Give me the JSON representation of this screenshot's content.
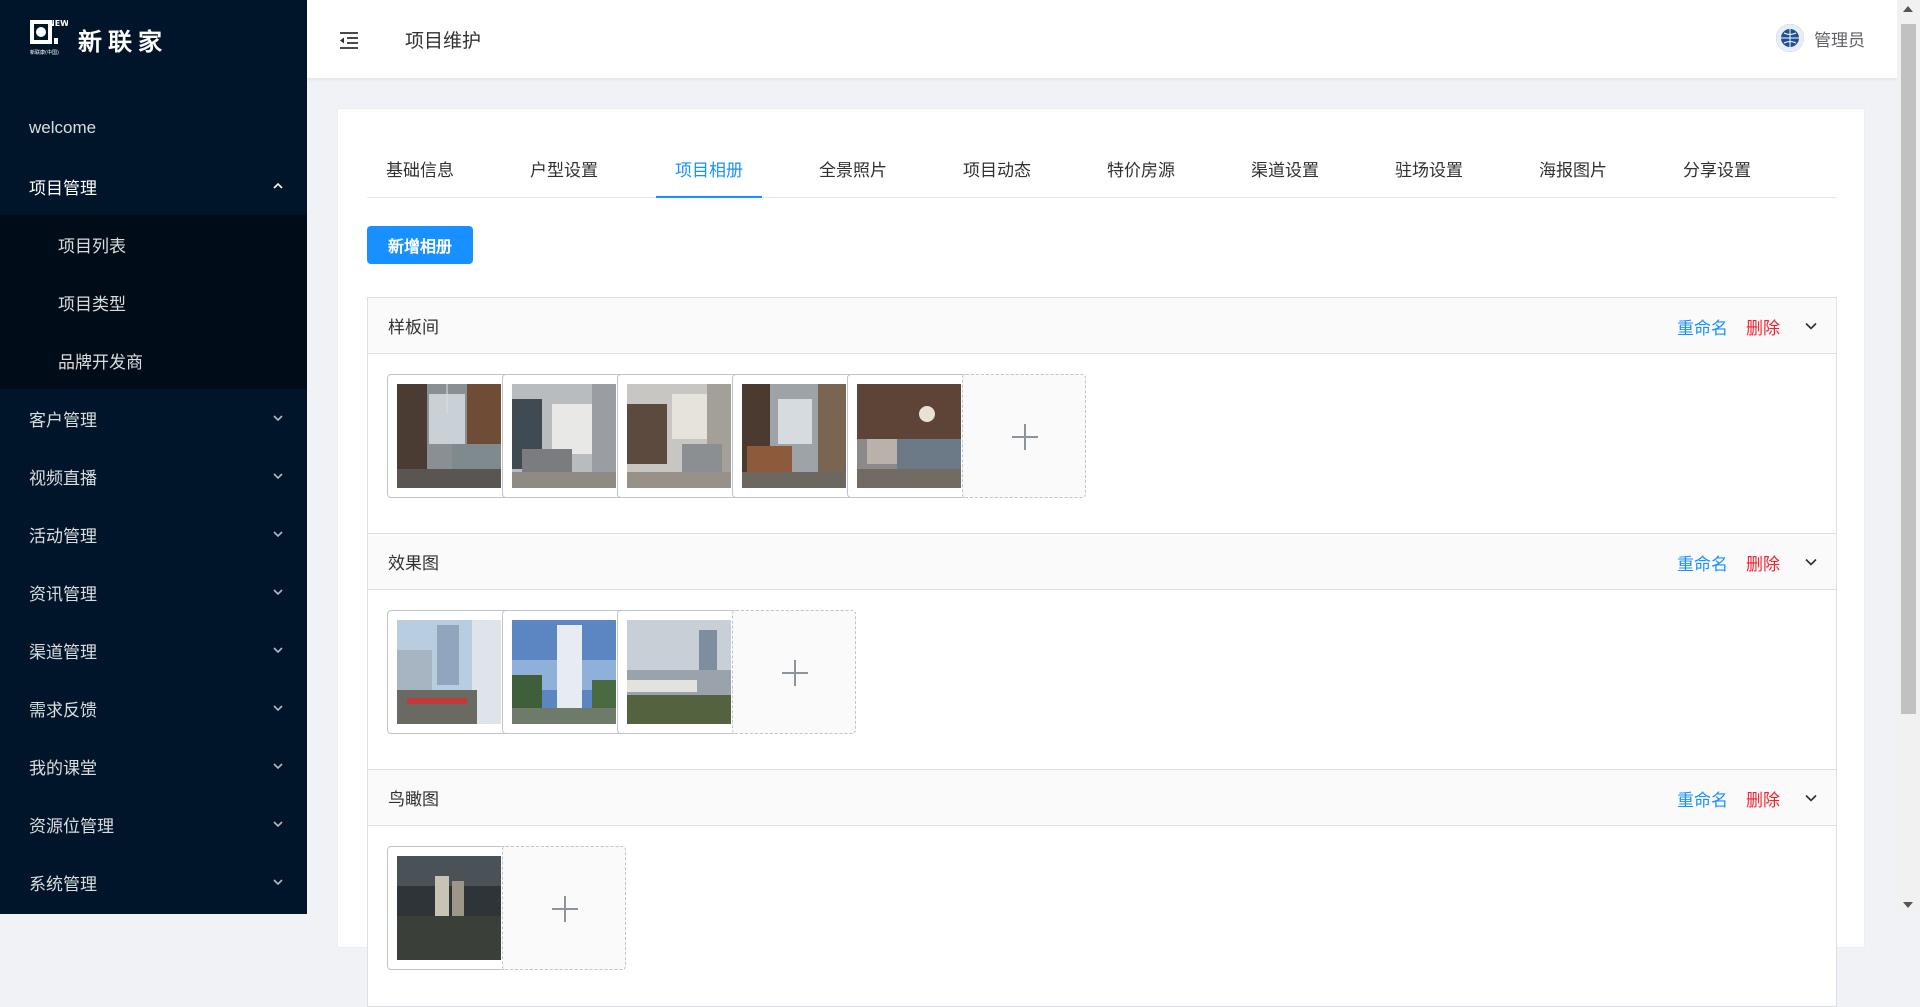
{
  "brand": {
    "name": "新联家",
    "logo_word": "NEW",
    "logo_caption": "新联康(中国)"
  },
  "sidebar": {
    "items": [
      {
        "label": "welcome"
      },
      {
        "label": "项目管理",
        "expanded": true
      },
      {
        "label": "客户管理"
      },
      {
        "label": "视频直播"
      },
      {
        "label": "活动管理"
      },
      {
        "label": "资讯管理"
      },
      {
        "label": "渠道管理"
      },
      {
        "label": "需求反馈"
      },
      {
        "label": "我的课堂"
      },
      {
        "label": "资源位管理"
      },
      {
        "label": "系统管理"
      }
    ],
    "subitems": [
      {
        "label": "项目列表"
      },
      {
        "label": "项目类型"
      },
      {
        "label": "品牌开发商"
      }
    ]
  },
  "header": {
    "title": "项目维护",
    "user": "管理员"
  },
  "tabs": [
    {
      "label": "基础信息"
    },
    {
      "label": "户型设置"
    },
    {
      "label": "项目相册",
      "active": true
    },
    {
      "label": "全景照片"
    },
    {
      "label": "项目动态"
    },
    {
      "label": "特价房源"
    },
    {
      "label": "渠道设置"
    },
    {
      "label": "驻场设置"
    },
    {
      "label": "海报图片"
    },
    {
      "label": "分享设置"
    }
  ],
  "add_album_label": "新增相册",
  "album_actions": {
    "rename": "重命名",
    "delete": "删除"
  },
  "albums": [
    {
      "title": "样板间",
      "photos": [
        "interior-1",
        "interior-2",
        "interior-3",
        "interior-4",
        "interior-5"
      ]
    },
    {
      "title": "效果图",
      "photos": [
        "render-1",
        "render-2",
        "render-3"
      ]
    },
    {
      "title": "鸟瞰图",
      "photos": [
        "aerial-1"
      ]
    }
  ],
  "colors": {
    "sidebar_bg": "#001529",
    "submenu_bg": "#000c17",
    "primary": "#1890ff",
    "danger": "#f5222d"
  }
}
